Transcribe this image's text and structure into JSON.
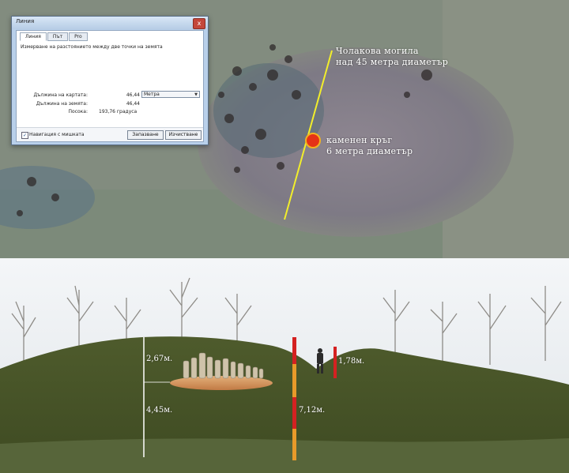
{
  "dialog": {
    "title": "Линия",
    "close": "x",
    "tabs": [
      "Линия",
      "Път",
      "Pro"
    ],
    "description": "Измерване на разстоянието между две точки на земята",
    "map_length_label": "Дължина на картата:",
    "map_length_value": "46,44",
    "unit": "Метра",
    "ground_length_label": "Дължина на земята:",
    "ground_length_value": "46,44",
    "heading_label": "Посока:",
    "heading_value": "193,76 градуса",
    "mouse_nav_label": "Навигация с мишката",
    "save_label": "Запазване",
    "clear_label": "Изчистване"
  },
  "satellite": {
    "mound_label_line1": "Чолакова могила",
    "mound_label_line2": "над 45 метра диаметър",
    "circle_label_line1": "каменен кръг",
    "circle_label_line2": "6 метра диаметър",
    "line_color": "#f2ee2b",
    "marker_color": "#e53217"
  },
  "photo": {
    "h1": "2,67м.",
    "h2": "4,45м.",
    "h3": "7,12м.",
    "h4": "1,78м.",
    "pole_red": "#d42121",
    "pole_orange": "#e89a2a"
  }
}
